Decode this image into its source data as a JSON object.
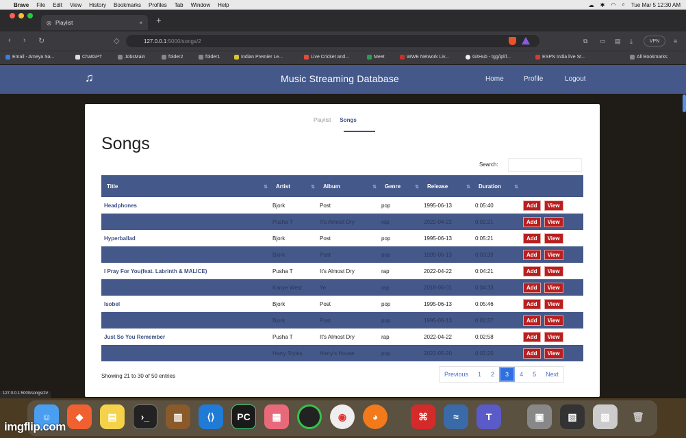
{
  "menubar": {
    "items": [
      "Brave",
      "File",
      "Edit",
      "View",
      "History",
      "Bookmarks",
      "Profiles",
      "Tab",
      "Window",
      "Help"
    ],
    "clock": "Tue Mar 5  12:30 AM"
  },
  "browser": {
    "tab_title": "Playlist",
    "url_host": "127.0.0.1",
    "url_path": ":5000/songs/2",
    "vpn_label": "VPN",
    "bookmarks": [
      "Email - Ameya Sa...",
      "ChatGPT",
      "JobsMain",
      "folder2",
      "folder1",
      "Indian Premier Le...",
      "Live Cricket and...",
      "Meet",
      "WWE Network Liv...",
      "GitHub - tgg/ipl/l...",
      "ESPN India live St..."
    ],
    "all_bookmarks": "All Bookmarks",
    "status_url": "127.0.0.1:5000/songs/2#"
  },
  "app": {
    "brand_icon": "music-note-icon",
    "title": "Music Streaming Database",
    "nav": [
      "Home",
      "Profile",
      "Logout"
    ]
  },
  "page": {
    "subtabs": [
      "Playlist",
      "Songs"
    ],
    "active_subtab": "Songs",
    "heading": "Songs",
    "search_label": "Search:",
    "search_value": ""
  },
  "table": {
    "columns": [
      "Title",
      "Artist",
      "Album",
      "Genre",
      "Release",
      "Duration",
      ""
    ],
    "rows": [
      {
        "title": "Headphones",
        "artist": "Bjork",
        "album": "Post",
        "genre": "pop",
        "release": "1995-06-13",
        "duration": "0:05:40"
      },
      {
        "title": "",
        "artist": "Pusha T",
        "album": "It's Almost Dry",
        "genre": "rap",
        "release": "2022-04-22",
        "duration": "0:02:21"
      },
      {
        "title": "Hyperballad",
        "artist": "Bjork",
        "album": "Post",
        "genre": "pop",
        "release": "1995-06-13",
        "duration": "0:05:21"
      },
      {
        "title": "",
        "artist": "Bjork",
        "album": "Post",
        "genre": "pop",
        "release": "1995-06-13",
        "duration": "0:03:39"
      },
      {
        "title": "I Pray For You(feat. Labrinth & MALICE)",
        "artist": "Pusha T",
        "album": "It's Almost Dry",
        "genre": "rap",
        "release": "2022-04-22",
        "duration": "0:04:21"
      },
      {
        "title": "",
        "artist": "Kanye West",
        "album": "Ye",
        "genre": "rap",
        "release": "2018-06-01",
        "duration": "0:04:33"
      },
      {
        "title": "Isobel",
        "artist": "Bjork",
        "album": "Post",
        "genre": "pop",
        "release": "1995-06-13",
        "duration": "0:05:46"
      },
      {
        "title": "",
        "artist": "Bjork",
        "album": "Post",
        "genre": "pop",
        "release": "1995-06-13",
        "duration": "0:02:37"
      },
      {
        "title": "Just So You Remember",
        "artist": "Pusha T",
        "album": "It's Almost Dry",
        "genre": "rap",
        "release": "2022-04-22",
        "duration": "0:02:58"
      },
      {
        "title": "",
        "artist": "Harry Styles",
        "album": "Harry's House",
        "genre": "pop",
        "release": "2022-05-20",
        "duration": "0:02:20"
      }
    ],
    "add_label": "Add",
    "view_label": "View"
  },
  "footer": {
    "showing": "Showing 21 to 30 of 50 entries",
    "pager": [
      "Previous",
      "1",
      "2",
      "3",
      "4",
      "5",
      "Next"
    ],
    "current_page": "3"
  },
  "colors": {
    "navbar": "#44588a",
    "button_red": "#b81f1f",
    "page_active": "#2f6fde"
  },
  "watermark": "imgflip.com"
}
